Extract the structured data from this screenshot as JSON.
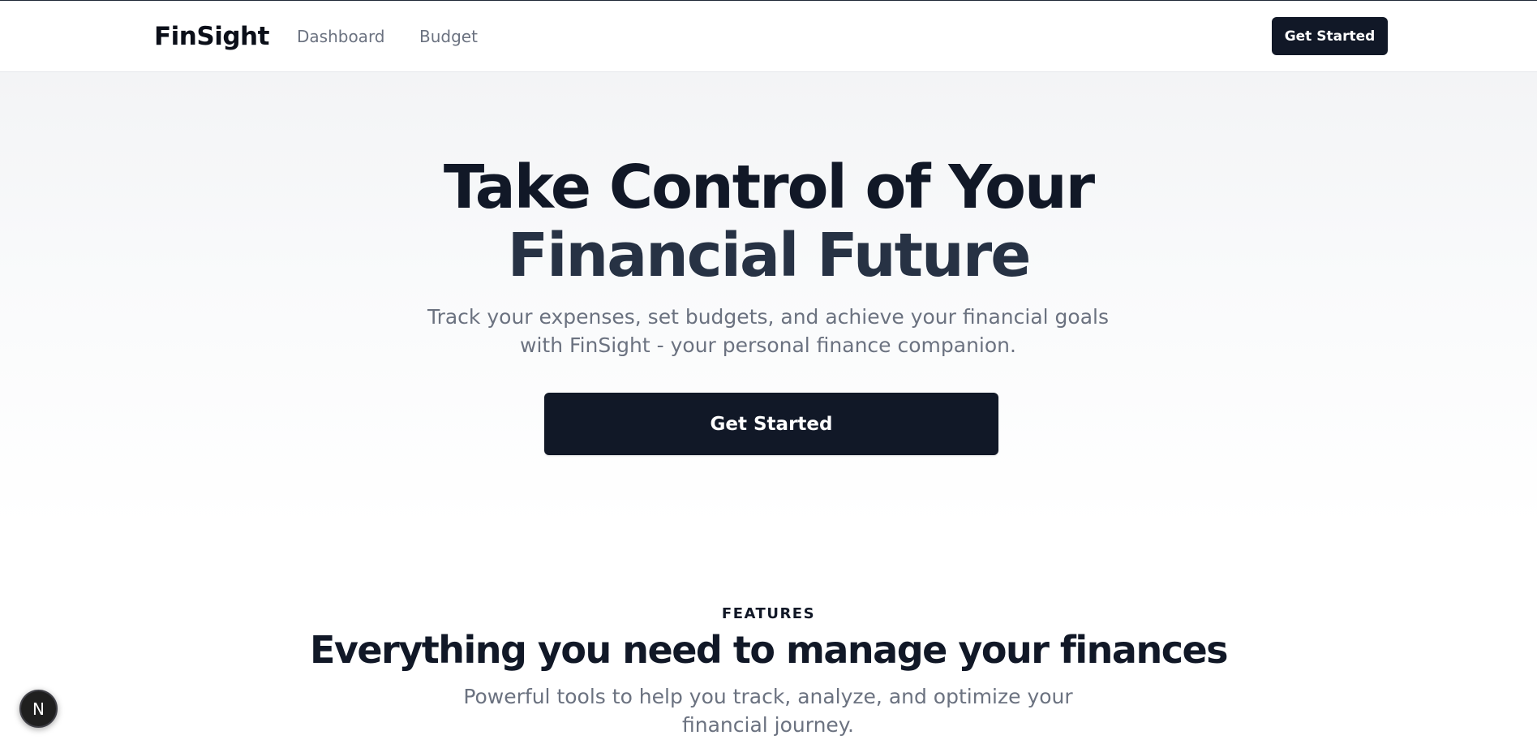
{
  "header": {
    "brand": "FinSight",
    "nav_links": [
      {
        "label": "Dashboard"
      },
      {
        "label": "Budget"
      }
    ],
    "cta_label": "Get Started"
  },
  "hero": {
    "title_line1": "Take Control of Your",
    "title_line2": "Financial Future",
    "subtitle": "Track your expenses, set budgets, and achieve your financial goals with FinSight - your personal finance companion.",
    "cta_label": "Get Started"
  },
  "features": {
    "eyebrow": "FEATURES",
    "title": "Everything you need to manage your finances",
    "subtitle": "Powerful tools to help you track, analyze, and optimize your financial journey."
  },
  "devtools": {
    "icon": "nextjs-logo-icon",
    "glyph": "N"
  },
  "colors": {
    "primary": "#111827",
    "muted_text": "#6b7280",
    "background": "#ffffff"
  }
}
